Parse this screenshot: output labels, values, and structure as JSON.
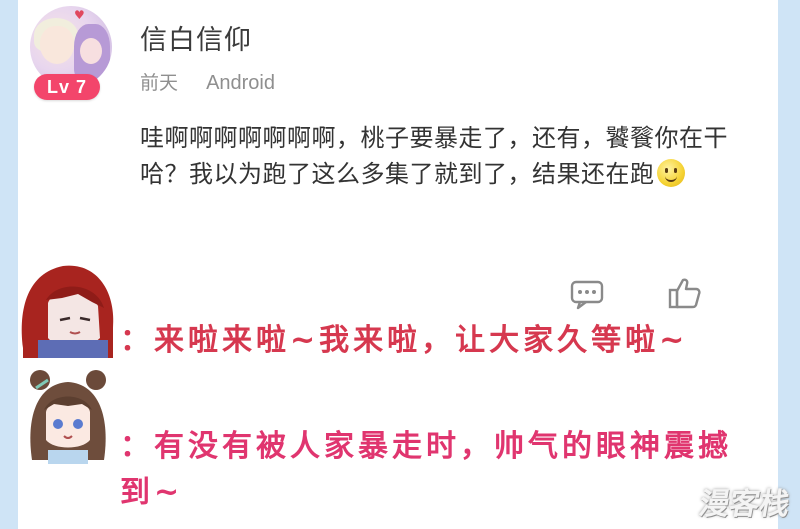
{
  "post": {
    "username": "信白信仰",
    "level_badge": "Lv 7",
    "time": "前天",
    "device": "Android",
    "comment_text": "哇啊啊啊啊啊啊啊，桃子要暴走了，还有，饕餮你在干哈？我以为跑了这么多集了就到了，结果还在跑"
  },
  "actions": {
    "reply_icon": "comment-bubble-icon",
    "like_icon": "thumbs-up-icon"
  },
  "overlay": {
    "line1": "：来啦来啦~我来啦，让大家久等啦~",
    "line2": "：有没有被人家暴走时，帅气的眼神震撼到~",
    "watermark": "漫客栈"
  },
  "colors": {
    "level_badge": "#f3456b",
    "subtitle1": "#d6384f",
    "subtitle2": "#e0356f"
  }
}
